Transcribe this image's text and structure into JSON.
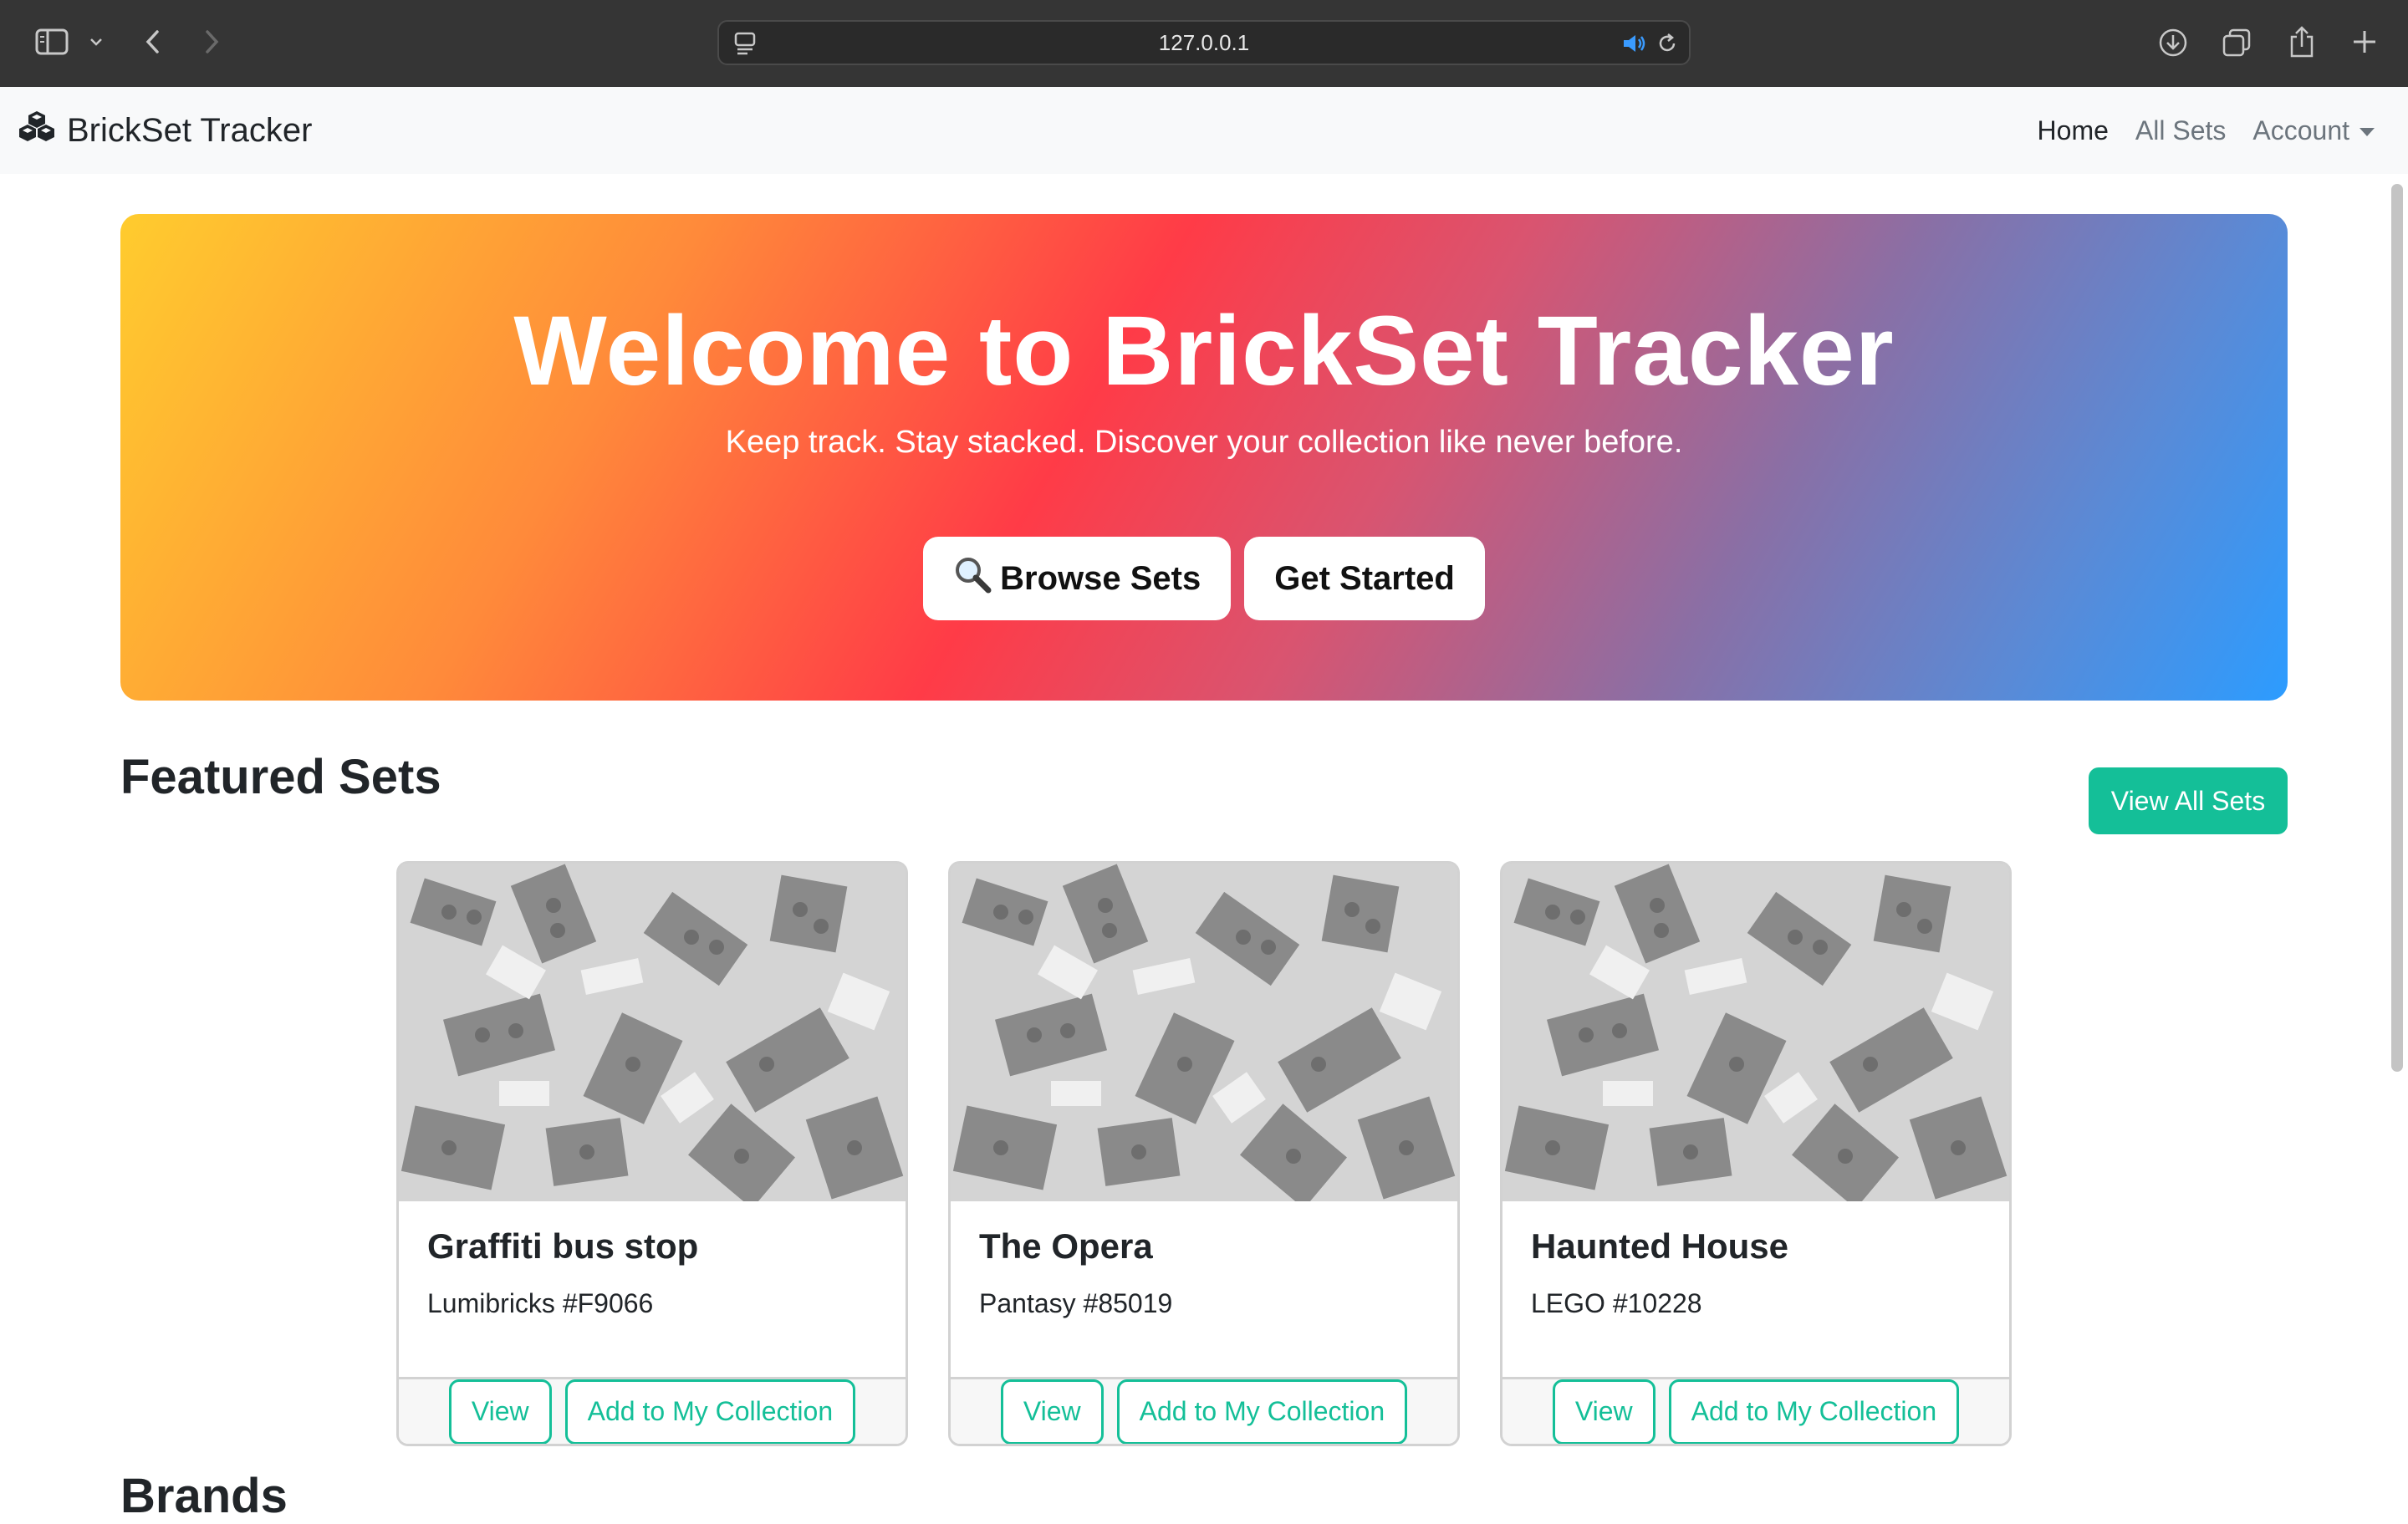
{
  "browser": {
    "url": "127.0.0.1"
  },
  "navbar": {
    "brand": "BrickSet Tracker",
    "links": {
      "home": "Home",
      "all_sets": "All Sets",
      "account": "Account"
    }
  },
  "hero": {
    "title": "Welcome to BrickSet Tracker",
    "subtitle": "Keep track. Stay stacked. Discover your collection like never before.",
    "browse_label": "Browse Sets",
    "get_started_label": "Get Started"
  },
  "featured": {
    "title": "Featured Sets",
    "view_all_label": "View All Sets",
    "cards": [
      {
        "name": "Graffiti bus stop",
        "subtitle": "Lumibricks #F9066",
        "view_label": "View",
        "add_label": "Add to My Collection"
      },
      {
        "name": "The Opera",
        "subtitle": "Pantasy #85019",
        "view_label": "View",
        "add_label": "Add to My Collection"
      },
      {
        "name": "Haunted House",
        "subtitle": "LEGO #10228",
        "view_label": "View",
        "add_label": "Add to My Collection"
      }
    ]
  },
  "brands": {
    "title": "Brands"
  },
  "colors": {
    "accent": "#14bf98",
    "chrome": "#353535",
    "navbar": "#f8f9fa"
  }
}
